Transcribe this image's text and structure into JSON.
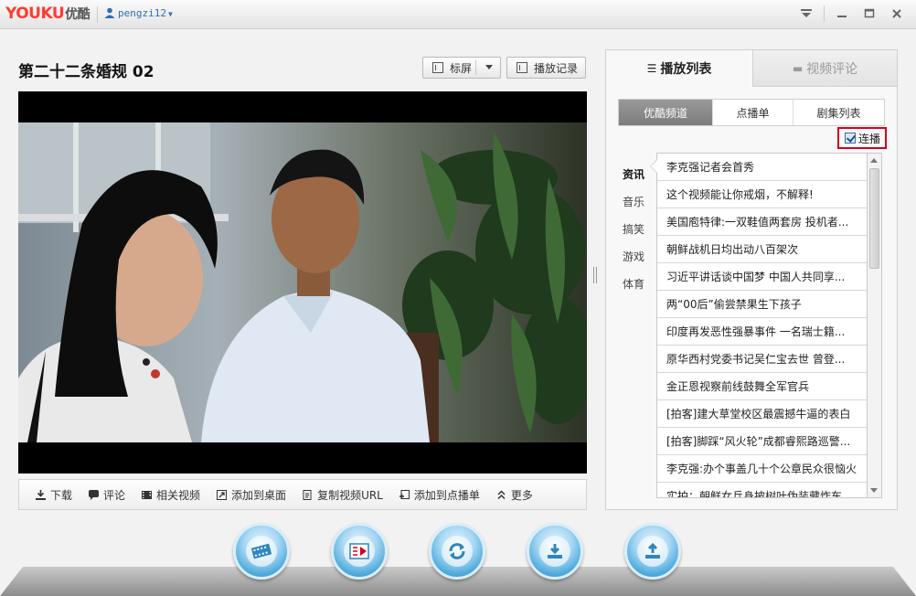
{
  "app": {
    "logo_brand": "YOUKU",
    "logo_cn": "优酷",
    "username": "pengzi12"
  },
  "window_controls": [
    "menu-icon",
    "minimize-icon",
    "maximize-icon",
    "close-icon"
  ],
  "video": {
    "title": "第二十二条婚规 02",
    "screen_mode_label": "标屏",
    "history_label": "播放记录"
  },
  "toolbar": {
    "items": [
      {
        "label": "下载",
        "icon": "download-icon"
      },
      {
        "label": "评论",
        "icon": "comment-icon"
      },
      {
        "label": "相关视频",
        "icon": "film-icon"
      },
      {
        "label": "添加到桌面",
        "icon": "desktop-icon"
      },
      {
        "label": "复制视频URL",
        "icon": "copy-icon"
      },
      {
        "label": "添加到点播单",
        "icon": "playlist-add-icon"
      },
      {
        "label": "更多",
        "icon": "more-icon"
      }
    ]
  },
  "panel": {
    "tabs": [
      {
        "label": "播放列表",
        "icon": "list-icon"
      },
      {
        "label": "视频评论",
        "icon": "comment-icon"
      }
    ],
    "subtabs": [
      "优酷频道",
      "点播单",
      "剧集列表"
    ],
    "autoplay_label": "连播",
    "categories": [
      "资讯",
      "音乐",
      "搞笑",
      "游戏",
      "体育"
    ],
    "items": [
      "李克强记者会首秀",
      "这个视频能让你戒烟，不解释!",
      "美国庖特律:一双鞋值两套房 投机者...",
      "朝鲜战机日均出动八百架次",
      "习近平讲话谈中国梦 中国人共同享...",
      "两“00后”偷尝禁果生下孩子",
      "印度再发恶性强暴事件 一名瑞士籍...",
      "原华西村党委书记吴仁宝去世 曾登...",
      "金正恩视察前线鼓舞全军官兵",
      "[拍客]建大草堂校区最震撼牛逼的表白",
      "[拍客]脚踩“风火轮”成都睿熙路巡警...",
      "李克强:办个事盖几十个公章民众很恼火",
      "实拍：朝鲜女兵身披树叶伪装藏炸车"
    ]
  },
  "dock": [
    "film-reel-icon",
    "video-list-icon",
    "refresh-icon",
    "download-tray-icon",
    "upload-tray-icon"
  ],
  "colors": {
    "brand_red": "#ff3b2f",
    "highlight_red": "#d0021b",
    "user_blue": "#2a6fb9"
  }
}
